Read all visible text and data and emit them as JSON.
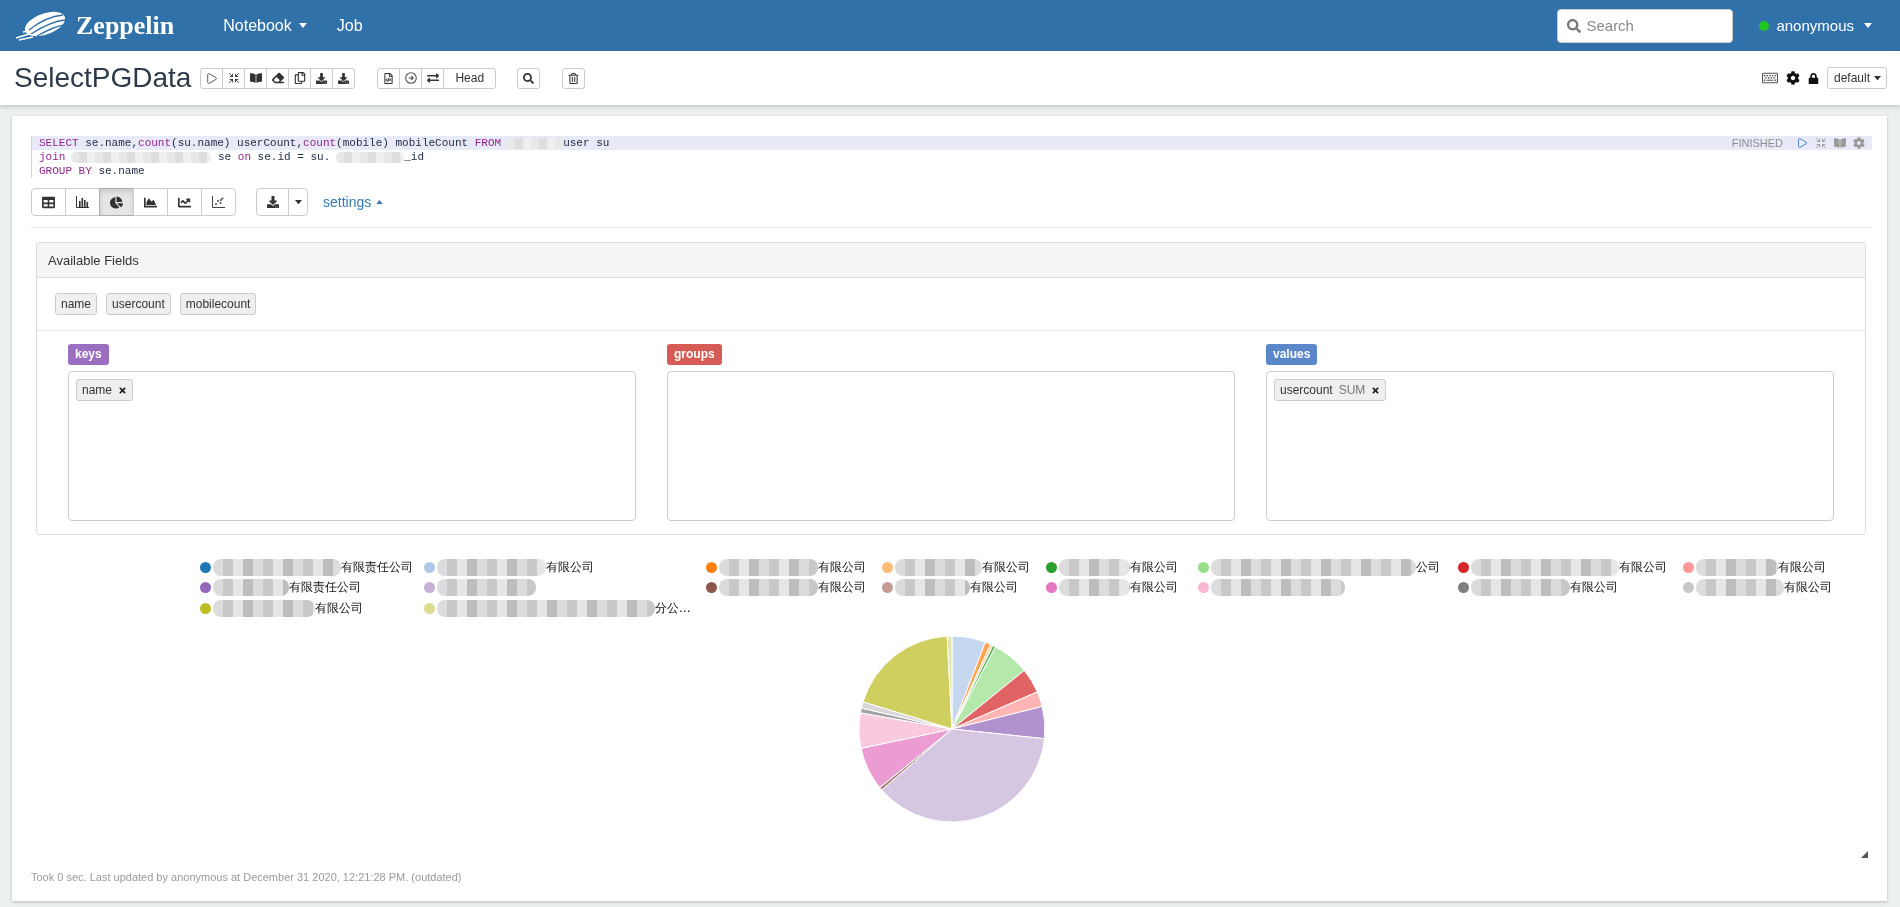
{
  "navbar": {
    "brand": "Zeppelin",
    "menu": [
      {
        "label": "Notebook",
        "dropdown": true
      },
      {
        "label": "Job",
        "dropdown": false
      }
    ],
    "search": {
      "placeholder": "Search"
    },
    "user": {
      "name": "anonymous",
      "online": true
    }
  },
  "notebook": {
    "title": "SelectPGData",
    "head_button": "Head",
    "interpreter": "default"
  },
  "paragraph": {
    "code": [
      {
        "active": true,
        "segments": [
          {
            "kind": "keyword",
            "text": "SELECT"
          },
          {
            "kind": "text",
            "text": " se.name,"
          },
          {
            "kind": "keyword",
            "text": "count"
          },
          {
            "kind": "text",
            "text": "(su.name) userCount,"
          },
          {
            "kind": "keyword",
            "text": "count"
          },
          {
            "kind": "text",
            "text": "(mobile) mobileCount "
          },
          {
            "kind": "keyword",
            "text": "FROM"
          },
          {
            "kind": "redacted"
          },
          {
            "kind": "text",
            "text": "user su"
          }
        ]
      },
      {
        "active": false,
        "segments": [
          {
            "kind": "keyword",
            "text": "join"
          },
          {
            "kind": "redacted"
          },
          {
            "kind": "text",
            "text": " se "
          },
          {
            "kind": "keyword",
            "text": "on"
          },
          {
            "kind": "text",
            "text": " se.id = su."
          },
          {
            "kind": "redacted"
          },
          {
            "kind": "text",
            "text": "_id"
          }
        ]
      },
      {
        "active": false,
        "segments": [
          {
            "kind": "keyword",
            "text": "GROUP BY"
          },
          {
            "kind": "text",
            "text": " se.name"
          }
        ]
      }
    ],
    "status": "FINISHED",
    "chart_types": [
      {
        "kind": "table",
        "selected": false
      },
      {
        "kind": "bar",
        "selected": false
      },
      {
        "kind": "pie",
        "selected": true
      },
      {
        "kind": "area",
        "selected": false
      },
      {
        "kind": "line",
        "selected": false
      },
      {
        "kind": "scatter",
        "selected": false
      }
    ],
    "settings": {
      "link": "settings",
      "expanded": true,
      "title": "Available Fields",
      "fields": [
        "name",
        "usercount",
        "mobilecount"
      ],
      "columns": [
        {
          "label": "keys",
          "color": "#9b6fc0",
          "chips": [
            {
              "name": "name"
            }
          ]
        },
        {
          "label": "groups",
          "color": "#d65a55"
        },
        {
          "label": "values",
          "color": "#5a87c7",
          "chips": [
            {
              "name": "usercount",
              "aggregation": "SUM"
            }
          ]
        }
      ]
    },
    "legend": [
      {
        "label": "有限责任公司",
        "color": "#1f77b4"
      },
      {
        "label": "有限公司",
        "color": "#aec7e8"
      },
      {
        "label": "有限公司",
        "color": "#ff7f0e"
      },
      {
        "label": "有限公司",
        "color": "#ffbb78"
      },
      {
        "label": "有限公司",
        "color": "#2ca02c"
      },
      {
        "label": "公司",
        "color": "#98df8a"
      },
      {
        "label": "有限公司",
        "color": "#d62728"
      },
      {
        "label": "有限公司",
        "color": "#ff9896"
      },
      {
        "label": "有限责任公司",
        "color": "#9467bd"
      },
      {
        "color": "#c5b0d5"
      },
      {
        "label": "有限公司",
        "color": "#8c564b"
      },
      {
        "label": "有限公司",
        "color": "#c49c94"
      },
      {
        "label": "有限公司",
        "color": "#e377c2"
      },
      {
        "color": "#f7b6d2"
      },
      {
        "label": "有限公司",
        "color": "#7f7f7f"
      },
      {
        "label": "有限公司",
        "color": "#c7c7c7"
      },
      {
        "label": "有限公司",
        "color": "#bcbd22"
      },
      {
        "label": "分公...",
        "color": "#dbdb8d"
      }
    ],
    "footer": "Took 0 sec. Last updated by anonymous at December 31 2020, 12:21:28 PM. (outdated)"
  }
}
